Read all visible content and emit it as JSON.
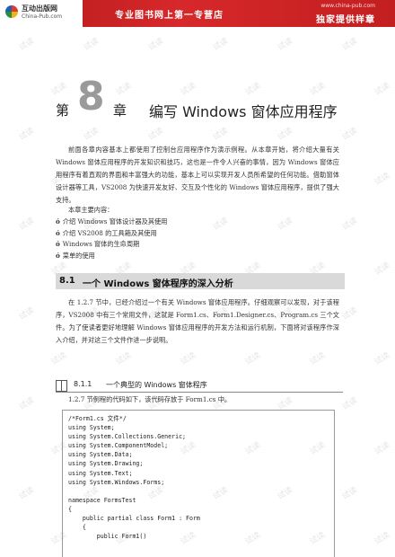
{
  "banner": {
    "logo_cn": "互动出版网",
    "logo_en": "China-Pub.com",
    "slogan": "专业图书网上第一专营店",
    "site_url": "www.china-pub.com",
    "slogan2": "独家提供样章"
  },
  "watermark": {
    "text": "试读"
  },
  "chapter": {
    "prefix": "第",
    "number": "8",
    "suffix": "章",
    "title": "编写 Windows 窗体应用程序"
  },
  "intro_paragraph": "前面各章内容基本上都使用了控制台应用程序作为演示例程。从本章开始，将介绍大量有关 Windows 窗体应用程序的开发知识和技巧，这也是一件令人兴奋的事情，因为 Windows 窗体应用程序有着直观的界面和丰富强大的功能，基本上可以实现开发人员所希望的任何功能。借助窗体设计器等工具，VS2008 为快速开发友好、交互及个性化的 Windows 窗体应用程序，提供了强大支持。",
  "contents_label": "本章主要内容：",
  "bullet_mark": "ó",
  "bullets": [
    "介绍 Windows 窗体设计器及其使用",
    "介绍 VS2008 的工具箱及其使用",
    "Windows 窗体的生命周期",
    "菜单的使用"
  ],
  "section": {
    "number": "8.1",
    "title": "一个 Windows 窗体程序的深入分析"
  },
  "section_paragraph": "在 1.2.7 节中，已经介绍过一个有关 Windows 窗体应用程序。仔细观察可以发现，对于该程序，VS2008 中有三个常用文件，这就是 Form1.cs、Form1.Designer.cs、Program.cs 三个文件。为了使读者更好地理解 Windows 窗体应用程序的开发方法和运行机制，下面将对该程序作深入介绍，并对这三个文件作进一步说明。",
  "subsection": {
    "number": "8.1.1",
    "title": "一个典型的 Windows 窗体程序"
  },
  "code_intro": "1.2.7 节例程的代码如下，该代码存放于 Form1.cs 中。",
  "code_lines": [
    "/*Form1.cs 文件*/",
    "using System;",
    "using System.Collections.Generic;",
    "using System.ComponentModel;",
    "using System.Data;",
    "using System.Drawing;",
    "using System.Text;",
    "using System.Windows.Forms;",
    "",
    "namespace FormsTest",
    "{",
    "    public partial class Form1 : Form",
    "    {",
    "        public Form1()"
  ]
}
